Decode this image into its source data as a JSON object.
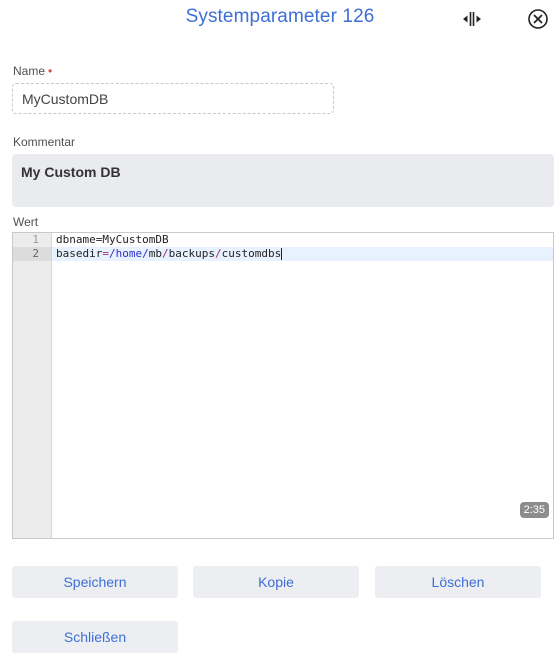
{
  "header": {
    "title": "Systemparameter 126"
  },
  "form": {
    "name_label": "Name",
    "required_marker": "•",
    "name_value": "MyCustomDB",
    "comment_label": "Kommentar",
    "comment_value": "My Custom DB",
    "value_label": "Wert"
  },
  "editor": {
    "line_numbers": [
      "1",
      "2"
    ],
    "line1_key": "dbname",
    "line1_eq": "=",
    "line1_value": "MyCustomDB",
    "line2_key": "basedir",
    "line2_eq": "=",
    "line2_seg1": "/home/",
    "line2_seg2": "mb",
    "line2_seg3": "/",
    "line2_seg4": "backups",
    "line2_seg5": "/",
    "line2_seg6": "customdbs",
    "cursor_position": "2:35"
  },
  "buttons": {
    "save": "Speichern",
    "copy": "Kopie",
    "delete": "Löschen",
    "close": "Schließen"
  },
  "colors": {
    "accent": "#3d6fd6",
    "required": "#e0453c",
    "button_bg": "#eceef2"
  }
}
